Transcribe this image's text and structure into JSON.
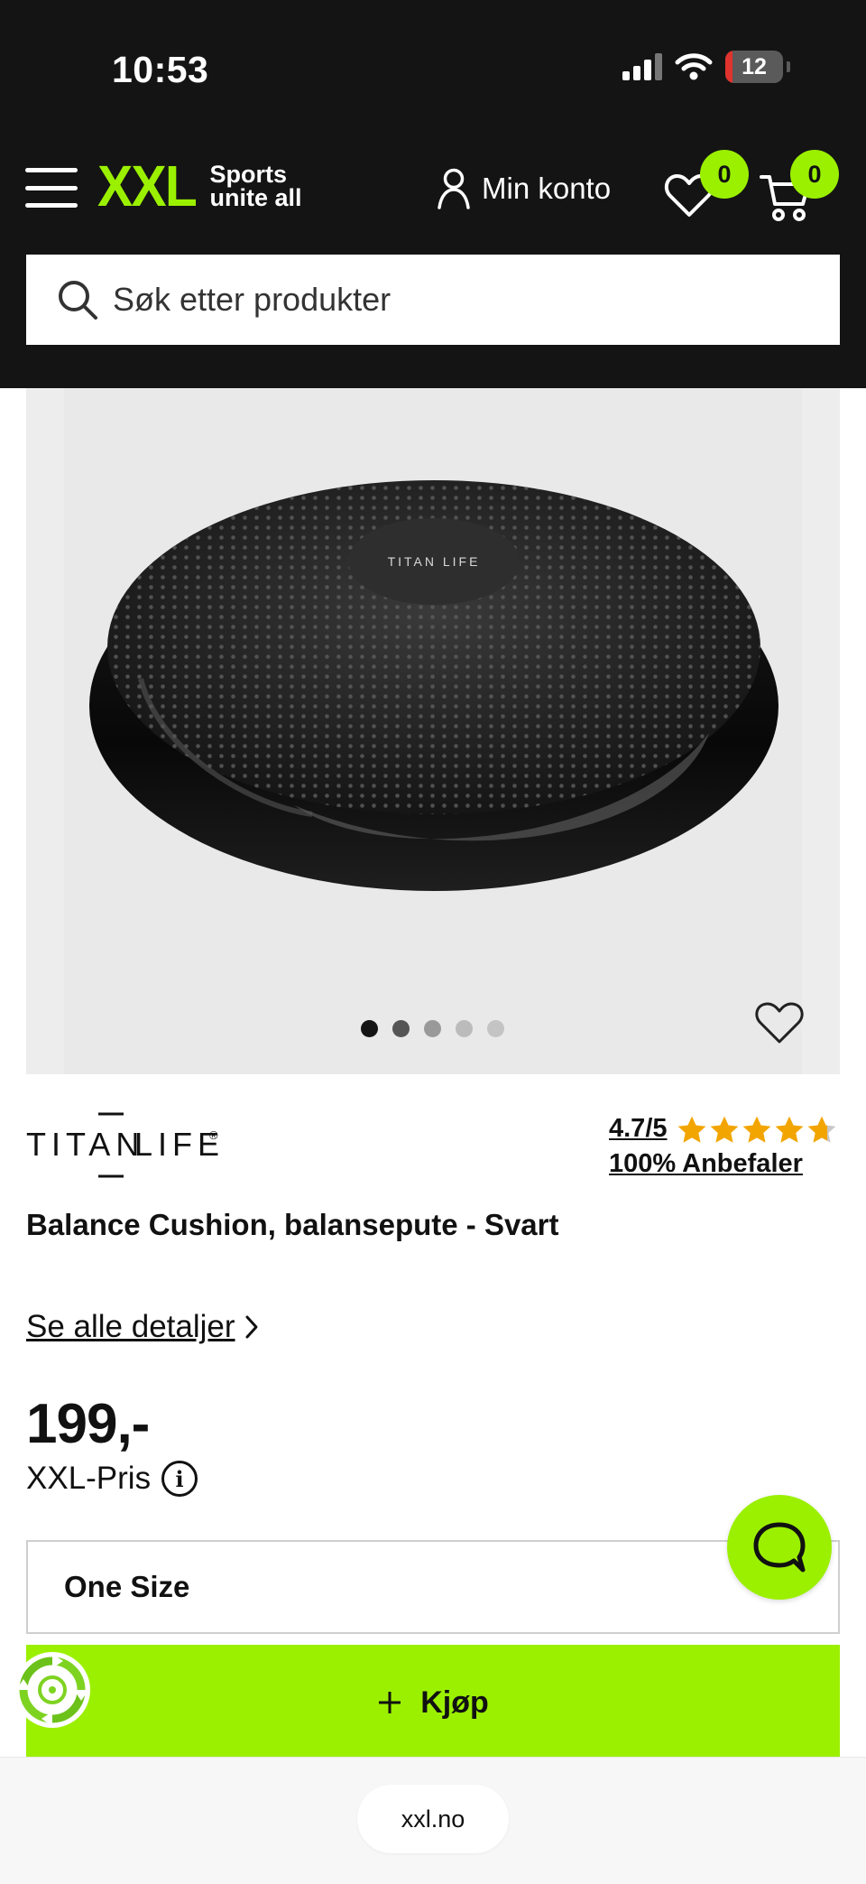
{
  "status_bar": {
    "time": "10:53",
    "battery_level": "12",
    "battery_fraction": 0.12
  },
  "header": {
    "logo_text": "XXL",
    "logo_tagline_1": "Sports",
    "logo_tagline_2": "unite all",
    "account_label": "Min konto",
    "wishlist_count": "0",
    "cart_count": "0",
    "brand_color": "#9bf000",
    "background_color": "#141414"
  },
  "search": {
    "placeholder": "Søk etter produkter"
  },
  "gallery": {
    "image_count": 5,
    "active_index": 0,
    "disc_brand_text": "TITAN LIFE"
  },
  "product": {
    "brand_part_1": "TITAN",
    "brand_part_2": "LIFE",
    "brand_mark": "®",
    "rating_text": "4.7/5",
    "rating_value": 4.7,
    "rating_max": 5,
    "recommend_text": "100% Anbefaler",
    "title": "Balance Cushion, balansepute - Svart",
    "details_link": "Se alle detaljer",
    "price": "199,-",
    "price_label": "XXL-Pris",
    "size_option": "One Size",
    "buy_label": "Kjøp",
    "star_color": "#f2a500"
  },
  "browser": {
    "url": "xxl.no"
  }
}
